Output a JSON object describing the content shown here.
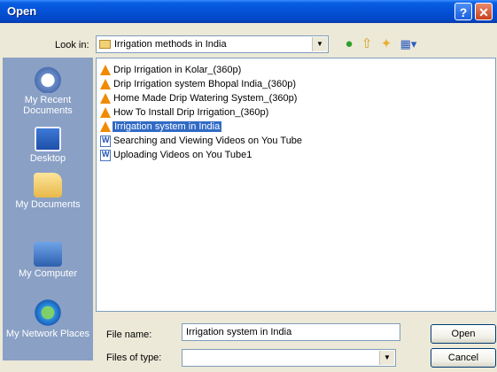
{
  "window": {
    "title": "Open",
    "help_glyph": "?",
    "close_glyph": "✕"
  },
  "lookin": {
    "label": "Look in:",
    "value": "Irrigation methods in India"
  },
  "toolbar": {
    "back_icon": "back-arrow-icon",
    "up_icon": "up-folder-icon",
    "new_folder_icon": "new-folder-icon",
    "views_icon": "views-menu-icon"
  },
  "places": [
    {
      "label": "My Recent Documents",
      "icon": "recent-documents-icon"
    },
    {
      "label": "Desktop",
      "icon": "desktop-icon"
    },
    {
      "label": "My Documents",
      "icon": "my-documents-icon"
    },
    {
      "label": "My Computer",
      "icon": "my-computer-icon"
    },
    {
      "label": "My Network Places",
      "icon": "network-places-icon"
    }
  ],
  "files": [
    {
      "name": "Drip Irrigation in Kolar_(360p)",
      "type": "vlc",
      "selected": false
    },
    {
      "name": "Drip Irrigation system Bhopal India_(360p)",
      "type": "vlc",
      "selected": false
    },
    {
      "name": "Home Made Drip Watering System_(360p)",
      "type": "vlc",
      "selected": false
    },
    {
      "name": "How To Install Drip Irrigation_(360p)",
      "type": "vlc",
      "selected": false
    },
    {
      "name": "Irrigation system in India",
      "type": "vlc",
      "selected": true
    },
    {
      "name": "Searching and Viewing Videos on You Tube",
      "type": "word",
      "selected": false
    },
    {
      "name": "Uploading Videos on You Tube1",
      "type": "word",
      "selected": false
    }
  ],
  "filename": {
    "label": "File name:",
    "value": "Irrigation system in India"
  },
  "filetype": {
    "label": "Files of type:",
    "value": ""
  },
  "buttons": {
    "open": "Open",
    "cancel": "Cancel"
  },
  "colors": {
    "titlebar": "#0453d8",
    "selection": "#316ac5",
    "places_bar": "#8aa0c5",
    "dialog_bg": "#ece9d8"
  }
}
